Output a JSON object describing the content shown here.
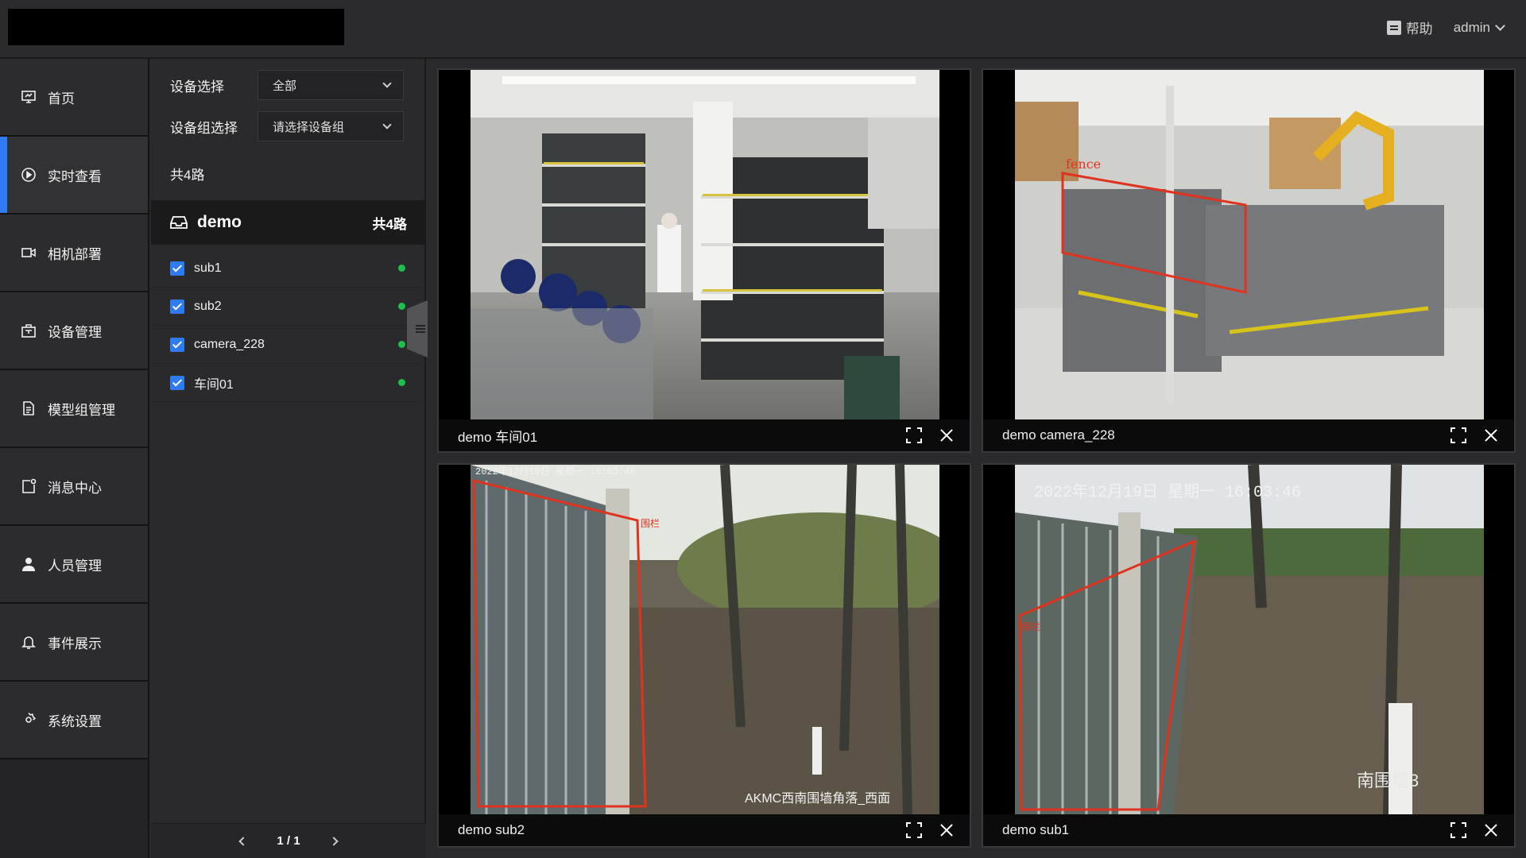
{
  "header": {
    "help_label": "帮助",
    "user_label": "admin"
  },
  "sidebar": {
    "items": [
      {
        "label": "首页",
        "icon": "monitor-icon"
      },
      {
        "label": "实时查看",
        "icon": "play-circle-icon",
        "active": true
      },
      {
        "label": "相机部署",
        "icon": "camera-icon"
      },
      {
        "label": "设备管理",
        "icon": "briefcase-icon"
      },
      {
        "label": "模型组管理",
        "icon": "document-icon"
      },
      {
        "label": "消息中心",
        "icon": "message-icon"
      },
      {
        "label": "人员管理",
        "icon": "person-icon"
      },
      {
        "label": "事件展示",
        "icon": "bell-icon"
      },
      {
        "label": "系统设置",
        "icon": "gear-icon"
      }
    ]
  },
  "filters": {
    "device_label": "设备选择",
    "device_value": "全部",
    "group_label": "设备组选择",
    "group_placeholder": "请选择设备组",
    "total": "共4路"
  },
  "group": {
    "name": "demo",
    "count": "共4路"
  },
  "devices": [
    {
      "name": "sub1",
      "checked": true,
      "status": "online"
    },
    {
      "name": "sub2",
      "checked": true,
      "status": "online"
    },
    {
      "name": "camera_228",
      "checked": true,
      "status": "online"
    },
    {
      "name": "车间01",
      "checked": true,
      "status": "online"
    }
  ],
  "pager": {
    "text": "1 / 1"
  },
  "tiles": [
    {
      "title": "demo 车间01",
      "osd": ""
    },
    {
      "title": "demo camera_228",
      "osd": "fence"
    },
    {
      "title": "demo sub2",
      "osd": "2022年12月19日 星期一 16:03:46",
      "region": "围栏",
      "caption": "AKMC西南围墙角落_西面"
    },
    {
      "title": "demo sub1",
      "osd": "2022年12月19日 星期一 16:03:46",
      "region": "围栏",
      "caption": "南围墙3"
    }
  ],
  "colors": {
    "accent": "#2f7bf6",
    "online": "#1fbf4c",
    "alarm_zone": "#e0331f"
  }
}
